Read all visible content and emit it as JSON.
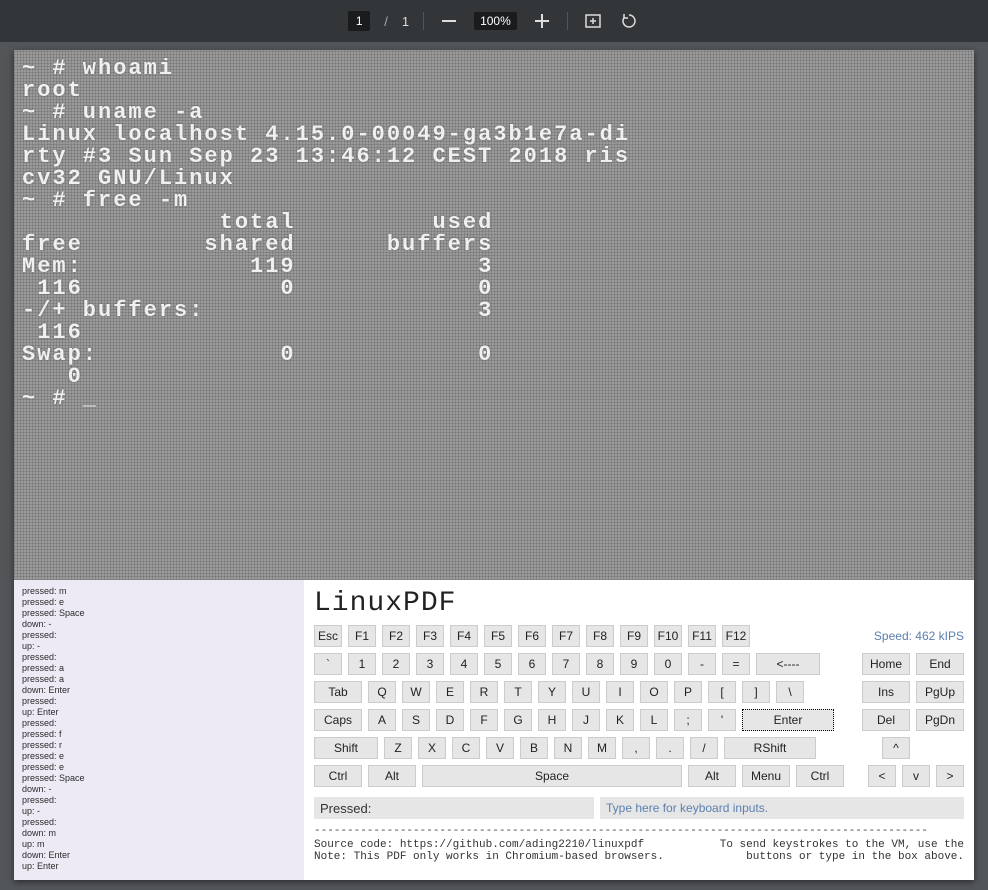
{
  "toolbar": {
    "page_current": "1",
    "page_sep": "/",
    "page_total": "1",
    "zoom": "100%"
  },
  "terminal": {
    "text": "~ # whoami\nroot\n~ # uname -a\nLinux localhost 4.15.0-00049-ga3b1e7a-di\nrty #3 Sun Sep 23 13:46:12 CEST 2018 ris\ncv32 GNU/Linux\n~ # free -m\n             total         used\nfree        shared      buffers\nMem:           119            3\n 116             0            0\n-/+ buffers:                  3\n 116\nSwap:            0            0\n   0\n~ # _"
  },
  "log": {
    "lines": [
      "pressed: m",
      "pressed: e",
      "pressed: Space",
      "down: -",
      "pressed:",
      "up: -",
      "pressed:",
      "pressed: a",
      "pressed: a",
      "down: Enter",
      "pressed:",
      "up: Enter",
      "pressed:",
      "pressed: f",
      "pressed: r",
      "pressed: e",
      "pressed: e",
      "pressed: Space",
      "down: -",
      "pressed:",
      "up: -",
      "pressed:",
      "down: m",
      "up: m",
      "down: Enter",
      "up: Enter"
    ]
  },
  "panel": {
    "title": "LinuxPDF",
    "speed": "Speed: 462 kIPS",
    "rows": {
      "fn": [
        "Esc",
        "F1",
        "F2",
        "F3",
        "F4",
        "F5",
        "F6",
        "F7",
        "F8",
        "F9",
        "F10",
        "F11",
        "F12"
      ],
      "num": [
        "`",
        "1",
        "2",
        "3",
        "4",
        "5",
        "6",
        "7",
        "8",
        "9",
        "0",
        "-",
        "="
      ],
      "back": "<----",
      "tab": "Tab",
      "q": [
        "Q",
        "W",
        "E",
        "R",
        "T",
        "Y",
        "U",
        "I",
        "O",
        "P",
        "[",
        "]",
        "\\"
      ],
      "caps": "Caps",
      "a": [
        "A",
        "S",
        "D",
        "F",
        "G",
        "H",
        "J",
        "K",
        "L",
        ";",
        "'"
      ],
      "enter": "Enter",
      "shift": "Shift",
      "z": [
        "Z",
        "X",
        "C",
        "V",
        "B",
        "N",
        "M",
        ",",
        ".",
        "/"
      ],
      "rshift": "RShift",
      "ctrl": "Ctrl",
      "alt": "Alt",
      "space": "Space",
      "ralt": "Alt",
      "menu": "Menu",
      "rctrl": "Ctrl",
      "nav": {
        "home": "Home",
        "end": "End",
        "ins": "Ins",
        "pgup": "PgUp",
        "del": "Del",
        "pgdn": "PgDn",
        "up": "^",
        "left": "<",
        "down": "v",
        "right": ">"
      }
    },
    "pressed_label": "Pressed:",
    "type_hint": "Type here for keyboard inputs.",
    "dashes": "---------------------------------------------------------------------------------------------",
    "src_line": "Source code: https://github.com/ading2210/linuxpdf",
    "note_line": "Note: This PDF only works in Chromium-based browsers.",
    "send_line1": "To send keystrokes to the VM, use the",
    "send_line2": "buttons or type in the box above."
  }
}
